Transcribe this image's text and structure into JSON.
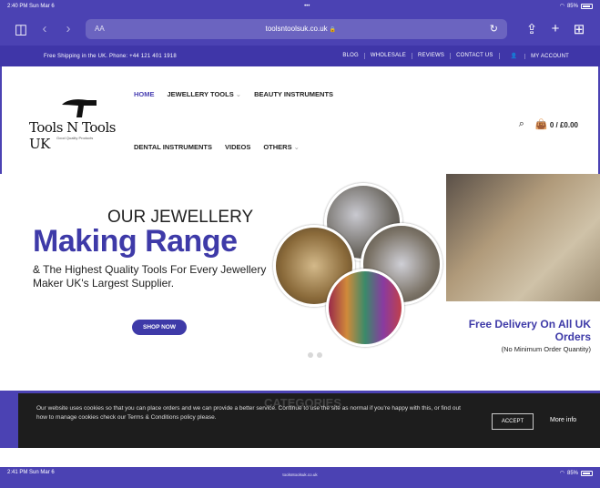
{
  "status_bar": {
    "time": "2:40 PM",
    "date": "Sun Mar 6",
    "dots": "•••",
    "battery": "85%"
  },
  "browser": {
    "text_size": "AA",
    "url": "toolsntoolsuk.co.uk",
    "lock": "🔒"
  },
  "topbar": {
    "shipping": "Free Shipping in the UK. Phone: +44 121 401 1918",
    "links": [
      "BLOG",
      "WHOLESALE",
      "REVIEWS",
      "CONTACT US",
      "MY ACCOUNT"
    ]
  },
  "header": {
    "logo_text": "Tools N Tools UK",
    "logo_tagline": "Good Quality Products",
    "nav_row1": [
      "HOME",
      "JEWELLERY TOOLS",
      "BEAUTY INSTRUMENTS"
    ],
    "nav_row2": [
      "DENTAL INSTRUMENTS",
      "VIDEOS",
      "OTHERS"
    ],
    "cart": "0 / £0.00"
  },
  "hero": {
    "line1": "OUR JEWELLERY",
    "line2": "Making Range",
    "line3": "& The Highest Quality Tools For Every Jewellery Maker UK's Largest Supplier.",
    "cta": "SHOP NOW",
    "delivery_title": "Free Delivery On All UK Orders",
    "delivery_note": "(No Minimum Order Quantity)"
  },
  "behind_text": "CATEGORIES",
  "cookie": {
    "message": "Our website uses cookies so that you can place orders and we can provide a better service. Continue to use the site as normal if you're happy with this, or find out how to manage cookies check our Terms & Conditions policy please.",
    "accept": "ACCEPT",
    "more": "More info"
  },
  "status_bar2": {
    "time": "2:41 PM",
    "date": "Sun Mar 6",
    "url": "toolsntoolsuk.co.uk",
    "battery": "85%"
  }
}
